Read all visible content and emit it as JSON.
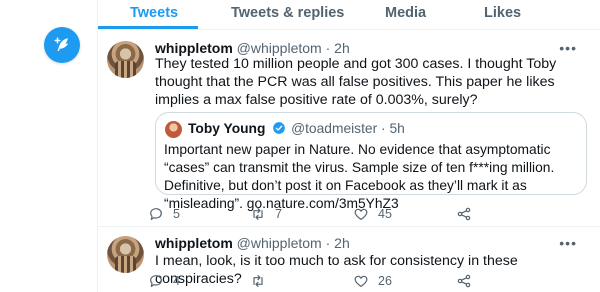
{
  "tabs": [
    {
      "label": "Tweets",
      "active": true
    },
    {
      "label": "Tweets & replies",
      "active": false
    },
    {
      "label": "Media",
      "active": false
    },
    {
      "label": "Likes",
      "active": false
    }
  ],
  "compose_button": {
    "icon": "feather-plus-icon",
    "color": "#1d9bf0"
  },
  "tweets": [
    {
      "name": "whippletom",
      "handle": "@whippletom",
      "dot": "·",
      "time": "2h",
      "more": "•••",
      "text": "They tested 10 million people and got 300 cases. I thought Toby thought that the PCR was all false positives. This paper he likes implies a max false positive rate of 0.003%, surely?",
      "quote": {
        "name": "Toby Young",
        "verified": true,
        "handle": "@toadmeister",
        "dot": "·",
        "time": "5h",
        "text": "Important new paper in Nature. No evidence that asymptomatic “cases” can transmit the virus. Sample size of ten f***ing million. Definitive, but don’t post it on Facebook as they’ll mark it as “misleading”. go.nature.com/3m5YhZ3"
      },
      "replies": "5",
      "retweets": "7",
      "likes": "45"
    },
    {
      "name": "whippletom",
      "handle": "@whippletom",
      "dot": "·",
      "time": "2h",
      "more": "•••",
      "text": "I mean, look, is it too much to ask for consistency in these conspiracies?",
      "replies": "4",
      "retweets": "",
      "likes": "26"
    }
  ],
  "colors": {
    "accent": "#1d9bf0",
    "muted": "#536471",
    "border": "#eff3f4",
    "verified": "#1d9bf0"
  }
}
